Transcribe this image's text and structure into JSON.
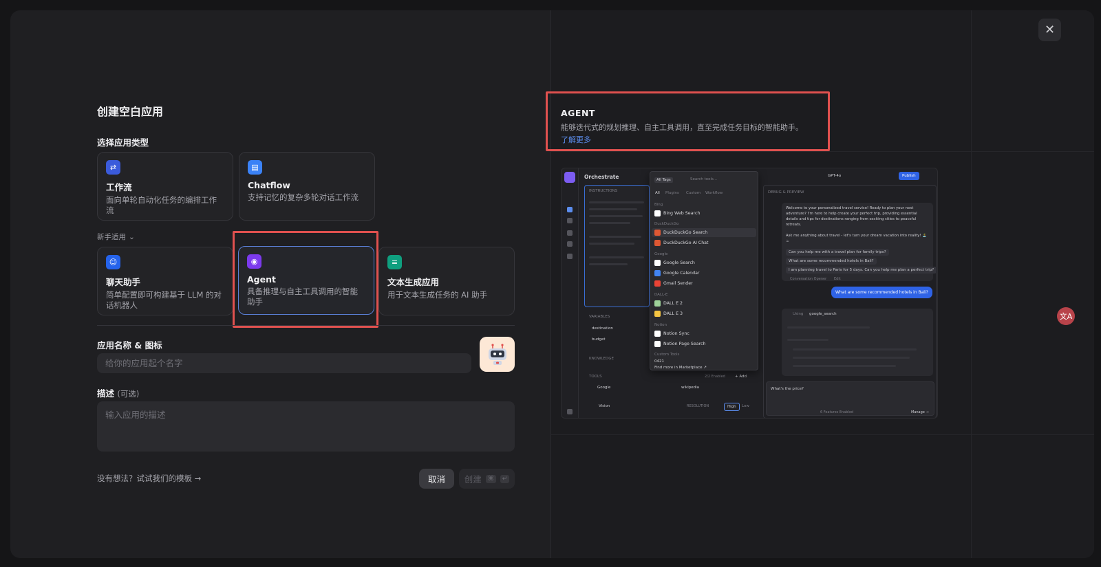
{
  "dialog": {
    "title": "创建空白应用",
    "close_icon": "close-icon",
    "type_section_label": "选择应用类型",
    "primary_types": [
      {
        "name": "工作流",
        "desc": "面向单轮自动化任务的编排工作流",
        "icon": "workflow-icon",
        "color": "#3b5bdb"
      },
      {
        "name": "Chatflow",
        "desc": "支持记忆的复杂多轮对话工作流",
        "icon": "chatflow-icon",
        "color": "#3b82f6"
      }
    ],
    "newbie_label": "新手适用",
    "newbie_types": [
      {
        "name": "聊天助手",
        "desc": "简单配置即可构建基于 LLM 的对话机器人",
        "icon": "chat-assistant-icon",
        "color": "#2563eb"
      },
      {
        "name": "Agent",
        "desc": "具备推理与自主工具调用的智能助手",
        "icon": "agent-icon",
        "color": "#7c3aed"
      },
      {
        "name": "文本生成应用",
        "desc": "用于文本生成任务的 AI 助手",
        "icon": "text-gen-icon",
        "color": "#0f9f7f"
      }
    ],
    "name_label": "应用名称 & 图标",
    "name_placeholder": "给你的应用起个名字",
    "desc_label": "描述",
    "desc_optional": "(可选)",
    "desc_placeholder": "输入应用的描述",
    "templates_link": "没有想法？试试我们的模板 →",
    "cancel_label": "取消",
    "create_label": "创建",
    "create_kbd": [
      "⌘",
      "↵"
    ]
  },
  "preview_info": {
    "title": "AGENT",
    "desc": "能够迭代式的规划推理、自主工具调用，直至完成任务目标的智能助手。",
    "learn_more": "了解更多"
  },
  "preview": {
    "orchestrate": "Orchestrate",
    "instructions": "INSTRUCTIONS",
    "variables": "VARIABLES",
    "var_1": "destination",
    "var_2": "budget",
    "knowledge": "KNOWLEDGE",
    "tools": "TOOLS",
    "tools_enabled": "2/2 Enabled",
    "add": "+ Add",
    "tool_1": "Google",
    "tool_2": "wikipedia",
    "vision": "Vision",
    "resolution": "RESOLUTION",
    "high": "High",
    "low": "Low",
    "all_tags": "All Tags",
    "search_tools": "Search tools...",
    "tabs": [
      "All",
      "Plugins",
      "Custom",
      "Workflow"
    ],
    "dropdown": [
      {
        "cat": "Bing",
        "items": [
          "Bing Web Search"
        ]
      },
      {
        "cat": "DuckDuckGo",
        "items": [
          "DuckDuckGo Search",
          "DuckDuckGo AI Chat"
        ]
      },
      {
        "cat": "Google",
        "items": [
          "Google Search",
          "Google Calendar",
          "Gmail Sender"
        ]
      },
      {
        "cat": "DALL-E",
        "items": [
          "DALL E 2",
          "DALL E 3"
        ]
      },
      {
        "cat": "Notion",
        "items": [
          "Notion Sync",
          "Notion Page Search"
        ]
      },
      {
        "cat": "Custom Tools",
        "items": [
          "0421"
        ]
      }
    ],
    "marketplace": "Find more in Marketplace ↗",
    "model": "GPT-4o",
    "publish": "Publish",
    "debug": "DEBUG & PREVIEW",
    "bot_msg_1": "Welcome to your personalized travel service! Ready to plan your next adventure? I'm here to help create your perfect trip, providing essential details and tips for destinations ranging from exciting cities to peaceful retreats.",
    "bot_msg_2": "Ask me anything about travel - let's turn your dream vacation into reality! 🏝️☕",
    "suggestions": [
      "Can you help me with a travel plan for family trips?",
      "What are some recommended hotels in Bali?",
      "I am planning travel to Paris for 5 days. Can you help me plan a perfect trip?"
    ],
    "conv_opener": "Conversation Opener",
    "edit": "Edit",
    "user_msg": "What are some recommended hotels in Bali?",
    "using": "Using",
    "using_tool": "google_search",
    "input_text": "What's the price?",
    "features": "6 Features Enabled",
    "manage": "Manage →"
  },
  "side_badge": "文A"
}
